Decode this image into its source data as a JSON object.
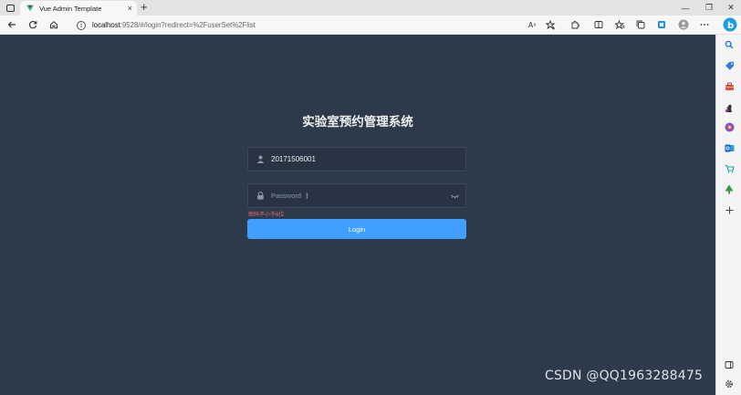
{
  "browser": {
    "tab_title": "Vue Admin Template",
    "new_tab_symbol": "+",
    "close_symbol": "×",
    "url_host": "localhost",
    "url_rest": ":9528/#/login?redirect=%2FuserSet%2Flist",
    "window_controls": [
      "—",
      "❐",
      "✕"
    ]
  },
  "login": {
    "title": "实验室预约管理系统",
    "username_value": "20171506001",
    "password_placeholder": "Password",
    "error_text": "密码不小于6位",
    "button_label": "Login"
  },
  "watermark": "CSDN @QQ1963288475",
  "colors": {
    "page_bg": "#2d3a4b",
    "input_bg": "#283443",
    "button": "#409eff",
    "error": "#f56c6c",
    "title": "#eeeeee"
  },
  "icons": [
    "tab-actions-icon",
    "vue-favicon-icon",
    "back-icon",
    "refresh-icon",
    "home-icon",
    "info-icon",
    "read-aloud-icon",
    "add-favorite-icon",
    "extensions-icon",
    "split-screen-icon",
    "favorites-icon",
    "collections-icon",
    "screenshot-icon",
    "profile-icon",
    "more-icon",
    "bing-icon",
    "search-icon",
    "tag-icon",
    "toolbox-icon",
    "chess-icon",
    "office-icon",
    "outlook-icon",
    "shopping-icon",
    "tree-icon",
    "add-icon",
    "user-icon",
    "lock-icon",
    "eye-closed-icon"
  ]
}
